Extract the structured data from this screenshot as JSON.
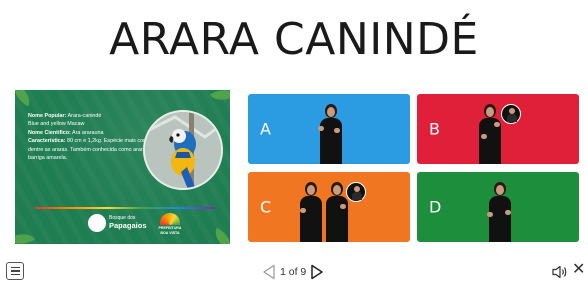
{
  "title": "ARARA CANINDÉ",
  "info_card": {
    "popular_label": "Nome Popular:",
    "popular_value": "Arara-canindé",
    "english_name": "Blue and yellow Macaw",
    "scientific_label": "Nome Científico:",
    "scientific_value": "Ara ararauna",
    "features_label": "Característica:",
    "features_value": "80 cm e 1,2kg. Espécie mais comum dentre as araras. Também conhecida como arara de barriga amarela.",
    "logo_left_small": "Bosque dos",
    "logo_left_big": "Papagaios",
    "logo_right_line1": "PREFEITURA",
    "logo_right_line2": "BOA VISTA"
  },
  "options": [
    {
      "letter": "A",
      "color": "#2b9be2"
    },
    {
      "letter": "B",
      "color": "#df2038"
    },
    {
      "letter": "C",
      "color": "#f07621"
    },
    {
      "letter": "D",
      "color": "#1c8e3c"
    }
  ],
  "pager": {
    "text": "1 of 9"
  },
  "icons": {
    "menu": "hamburger-menu-icon",
    "prev": "triangle-left-icon",
    "next": "triangle-right-icon",
    "sound": "speaker-icon",
    "close": "close-icon"
  }
}
